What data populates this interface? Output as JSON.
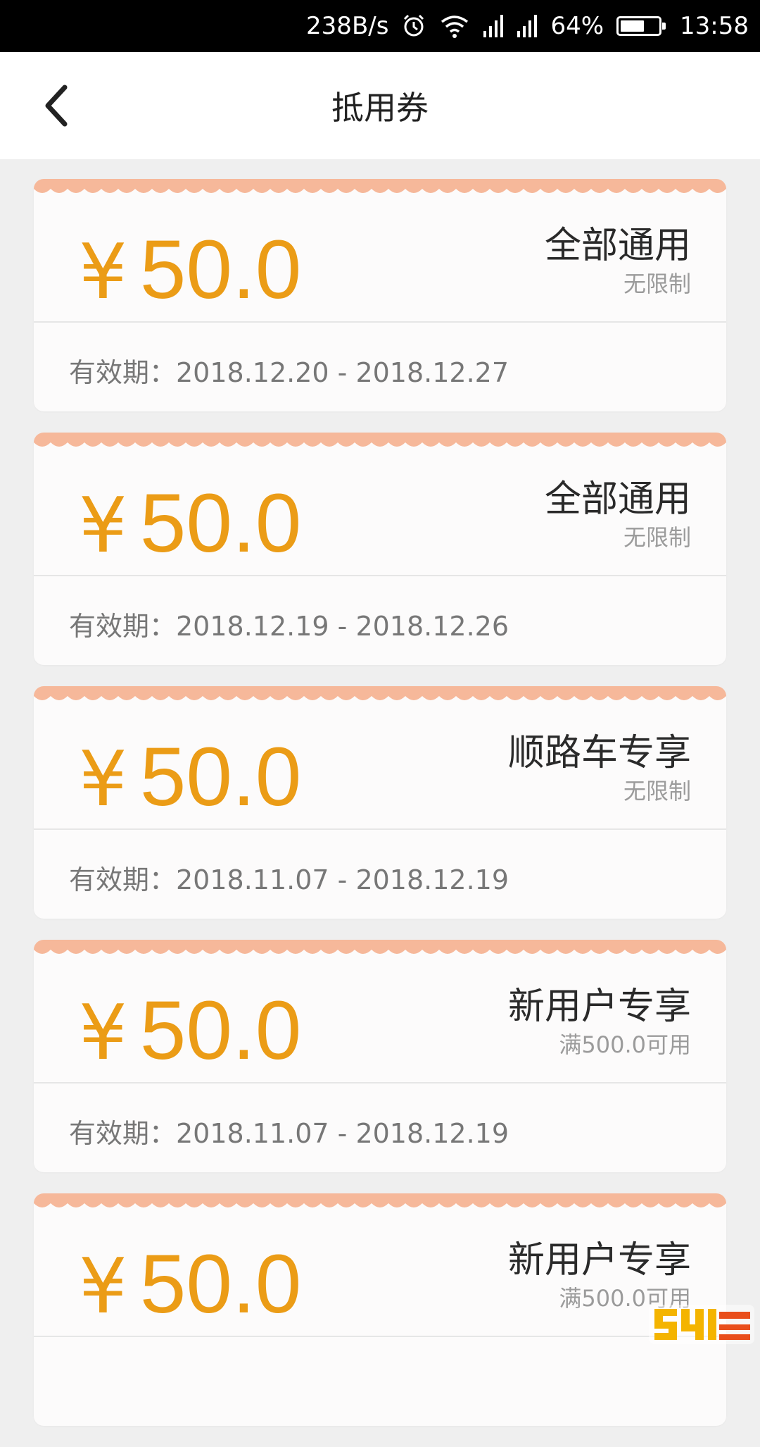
{
  "status_bar": {
    "net_speed": "238B/s",
    "battery": "64%",
    "battery_level": 0.64,
    "time": "13:58",
    "icons": [
      "alarm-icon",
      "wifi-icon",
      "signal-icon",
      "signal-icon",
      "battery-icon"
    ]
  },
  "header": {
    "title": "抵用券",
    "back_icon": "chevron-left-icon"
  },
  "colors": {
    "accent": "#eb9c16",
    "wave": "#f6b89a",
    "card": "#fcfbfb",
    "background": "#efefef"
  },
  "coupons": [
    {
      "currency": "¥",
      "amount": "50.0",
      "type": "全部通用",
      "condition": "无限制",
      "validity": "有效期：2018.12.20 - 2018.12.27"
    },
    {
      "currency": "¥",
      "amount": "50.0",
      "type": "全部通用",
      "condition": "无限制",
      "validity": "有效期：2018.12.19 - 2018.12.26"
    },
    {
      "currency": "¥",
      "amount": "50.0",
      "type": "顺路车专享",
      "condition": "无限制",
      "validity": "有效期：2018.11.07 - 2018.12.19"
    },
    {
      "currency": "¥",
      "amount": "50.0",
      "type": "新用户专享",
      "condition": "满500.0可用",
      "validity": "有效期：2018.11.07 - 2018.12.19"
    },
    {
      "currency": "¥",
      "amount": "50.0",
      "type": "新用户专享",
      "condition": "满500.0可用",
      "validity": ""
    }
  ]
}
